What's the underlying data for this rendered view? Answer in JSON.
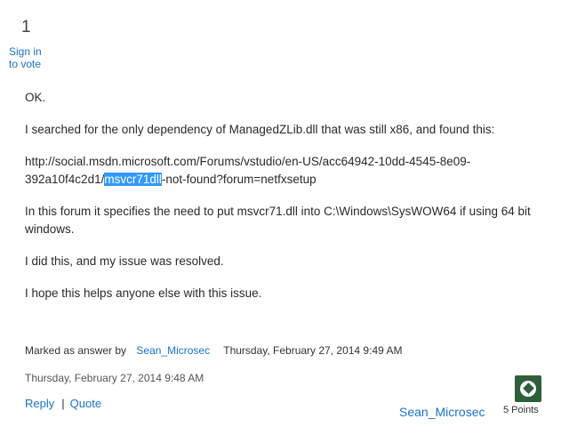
{
  "vote": {
    "count": "1",
    "sign_in_label": "Sign in to vote"
  },
  "post": {
    "line1": "OK.",
    "line2": "I searched for the only dependency of ManagedZLib.dll that was still x86, and found this:",
    "url_part1": "http://social.msdn.microsoft.com/Forums/vstudio/en-US/acc64942-10dd-4545-8e09-392a10f4c2d1/",
    "url_selected": "msvcr71dll",
    "url_part2": "-not-found?forum=netfxsetup",
    "line4": "In this forum it specifies the need to put msvcr71.dll into C:\\Windows\\SysWOW64 if using 64 bit windows.",
    "line5": "I did this, and my issue was resolved.",
    "line6": "I hope this helps anyone else with this issue."
  },
  "answer": {
    "marked_label": "Marked as answer by",
    "marked_by": "Sean_Microsec",
    "marked_date": "Thursday, February 27, 2014 9:49 AM"
  },
  "post_date": "Thursday, February 27, 2014 9:48 AM",
  "actions": {
    "reply": "Reply",
    "separator": "|",
    "quote": "Quote"
  },
  "author": {
    "name": "Sean_Microsec",
    "points": "5 Points"
  },
  "colors": {
    "link": "#1a73c8",
    "selection": "#3399ff",
    "avatar": "#2e5e3a"
  }
}
